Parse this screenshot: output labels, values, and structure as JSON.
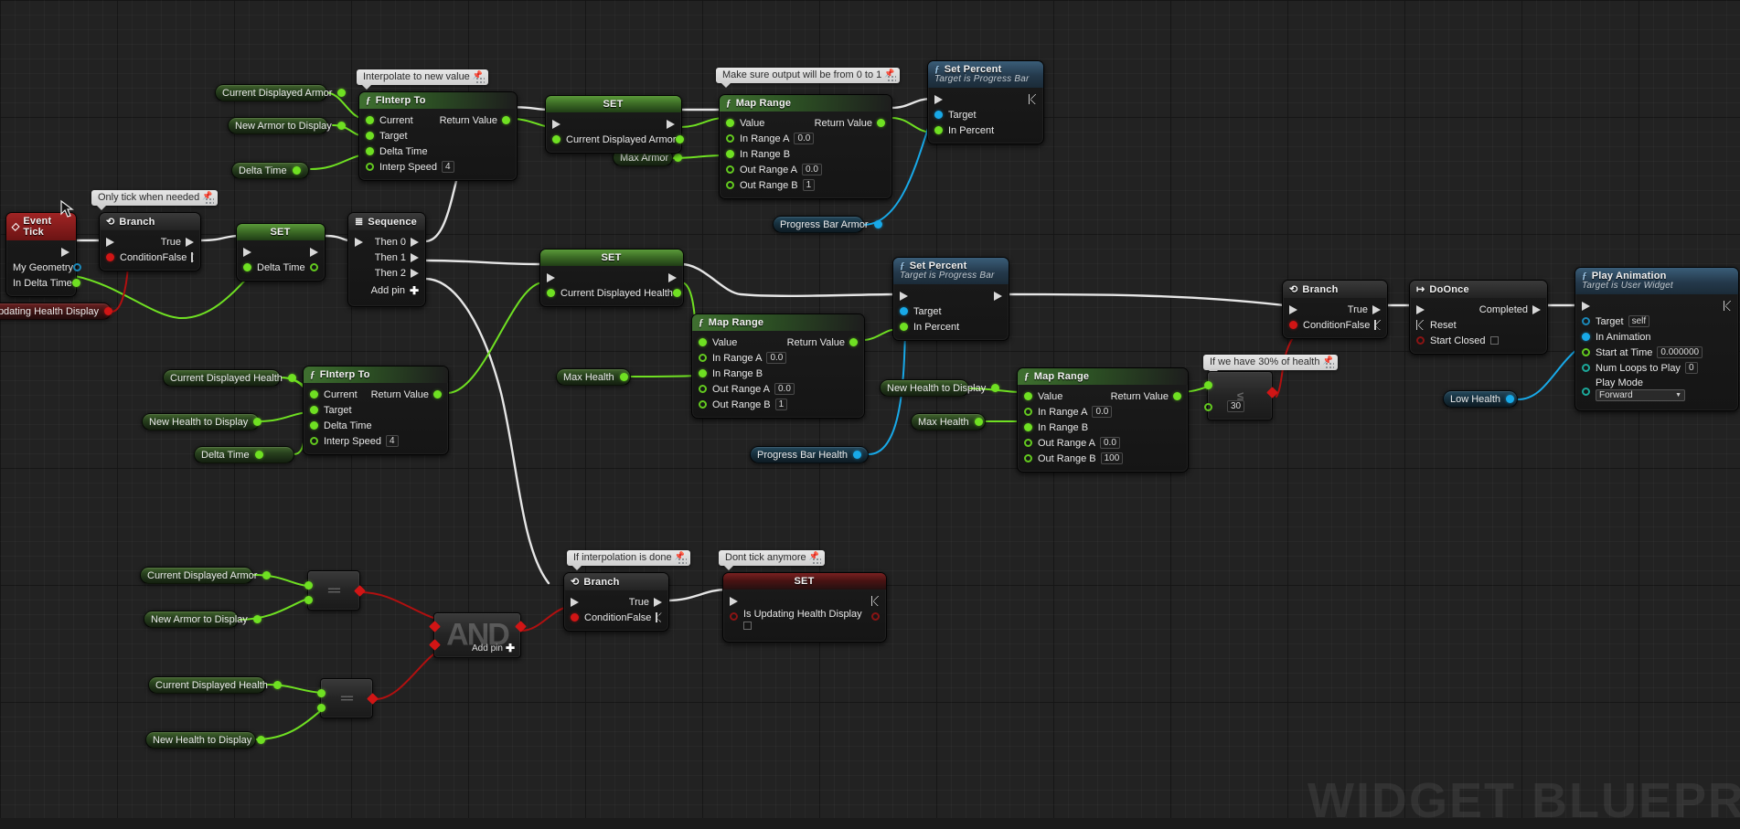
{
  "app": {
    "watermark": "WIDGET BLUEPRINT"
  },
  "comments": [
    {
      "id": "c-only-tick",
      "text": "Only tick when needed"
    },
    {
      "id": "c-interp",
      "text": "Interpolate to new value"
    },
    {
      "id": "c-clamp",
      "text": "Make sure output will be from 0 to 1"
    },
    {
      "id": "c-30pct",
      "text": "If we have 30% of health"
    },
    {
      "id": "c-interp-done",
      "text": "If interpolation is done"
    },
    {
      "id": "c-dont-tick",
      "text": "Dont tick anymore"
    }
  ],
  "nodes": {
    "event_tick": {
      "title": "Event Tick",
      "pins": [
        {
          "label": "My Geometry"
        },
        {
          "label": "In Delta Time"
        }
      ]
    },
    "branch_tick": {
      "title": "Branch",
      "in_label": "Condition",
      "true_label": "True",
      "false_label": "False"
    },
    "set_delta_time": {
      "title": "SET",
      "var_label": "Delta Time"
    },
    "sequence": {
      "title": "Sequence",
      "then0": "Then 0",
      "then1": "Then 1",
      "then2": "Then 2",
      "add_pin": "Add pin"
    },
    "finterp_armor": {
      "title": "FInterp To",
      "pins": [
        "Current",
        "Target",
        "Delta Time"
      ],
      "interp_speed_label": "Interp Speed",
      "interp_speed_value": "4",
      "return_label": "Return Value"
    },
    "finterp_health": {
      "title": "FInterp To",
      "pins": [
        "Current",
        "Target",
        "Delta Time"
      ],
      "interp_speed_label": "Interp Speed",
      "interp_speed_value": "4",
      "return_label": "Return Value"
    },
    "set_armor": {
      "title": "SET",
      "var_label": "Current Displayed Armor"
    },
    "set_health": {
      "title": "SET",
      "var_label": "Current Displayed Health"
    },
    "map_range_armor": {
      "title": "Map Range",
      "value_label": "Value",
      "return_label": "Return Value",
      "in_a_label": "In Range A",
      "in_a_value": "0.0",
      "in_b_label": "In Range B",
      "out_a_label": "Out Range A",
      "out_a_value": "0.0",
      "out_b_label": "Out Range B",
      "out_b_value": "1"
    },
    "map_range_health": {
      "title": "Map Range",
      "value_label": "Value",
      "return_label": "Return Value",
      "in_a_label": "In Range A",
      "in_a_value": "0.0",
      "in_b_label": "In Range B",
      "out_a_label": "Out Range A",
      "out_a_value": "0.0",
      "out_b_label": "Out Range B",
      "out_b_value": "1"
    },
    "map_range_pct": {
      "title": "Map Range",
      "value_label": "Value",
      "return_label": "Return Value",
      "in_a_label": "In Range A",
      "in_a_value": "0.0",
      "in_b_label": "In Range B",
      "out_a_label": "Out Range A",
      "out_a_value": "0.0",
      "out_b_label": "Out Range B",
      "out_b_value": "100"
    },
    "set_percent_armor": {
      "title": "Set Percent",
      "subtitle": "Target is Progress Bar",
      "target_label": "Target",
      "percent_label": "In Percent"
    },
    "set_percent_health": {
      "title": "Set Percent",
      "subtitle": "Target is Progress Bar",
      "target_label": "Target",
      "percent_label": "In Percent"
    },
    "branch_lowhealth": {
      "title": "Branch",
      "in_label": "Condition",
      "true_label": "True",
      "false_label": "False"
    },
    "doonce": {
      "title": "DoOnce",
      "completed_label": "Completed",
      "reset_label": "Reset",
      "start_closed_label": "Start Closed"
    },
    "play_animation": {
      "title": "Play Animation",
      "subtitle": "Target is User Widget",
      "target_label": "Target",
      "target_value": "self",
      "in_animation_label": "In Animation",
      "start_at_time_label": "Start at Time",
      "start_at_time_value": "0.000000",
      "num_loops_label": "Num Loops to Play",
      "num_loops_value": "0",
      "play_mode_label": "Play Mode",
      "play_mode_value": "Forward"
    },
    "branch_done": {
      "title": "Branch",
      "in_label": "Condition",
      "true_label": "True",
      "false_label": "False"
    },
    "set_is_updating": {
      "title": "SET",
      "var_label": "Is Updating Health Display"
    },
    "cmp_lte_30": {
      "glyph": "≤",
      "value": "30"
    },
    "cmp_eq_armor": {
      "glyph": "=="
    },
    "cmp_eq_health": {
      "glyph": "=="
    },
    "and_node": {
      "glyph": "AND",
      "add_pin": "Add pin"
    }
  },
  "variables": [
    {
      "id": "v-cda-top",
      "label": "Current Displayed Armor",
      "kind": "green"
    },
    {
      "id": "v-nad-top",
      "label": "New Armor to Display",
      "kind": "green"
    },
    {
      "id": "v-dt-top",
      "label": "Delta Time",
      "kind": "green"
    },
    {
      "id": "v-maxarmor",
      "label": "Max Armor",
      "kind": "green"
    },
    {
      "id": "v-pbarmor",
      "label": "Progress Bar Armor",
      "kind": "blue"
    },
    {
      "id": "v-uhd",
      "label": "Updating Health Display",
      "kind": "red"
    },
    {
      "id": "v-cdh-mid",
      "label": "Current Displayed Health",
      "kind": "green"
    },
    {
      "id": "v-nhd-mid",
      "label": "New Health to Display",
      "kind": "green"
    },
    {
      "id": "v-dt-mid",
      "label": "Delta Time",
      "kind": "green"
    },
    {
      "id": "v-maxhealth1",
      "label": "Max Health",
      "kind": "green"
    },
    {
      "id": "v-pbhealth",
      "label": "Progress Bar Health",
      "kind": "blue"
    },
    {
      "id": "v-nhd-r",
      "label": "New Health to Display",
      "kind": "green"
    },
    {
      "id": "v-maxhealth2",
      "label": "Max Health",
      "kind": "green"
    },
    {
      "id": "v-lowhealth",
      "label": "Low Health",
      "kind": "blue"
    },
    {
      "id": "v-cda-bot",
      "label": "Current Displayed Armor",
      "kind": "green"
    },
    {
      "id": "v-nad-bot",
      "label": "New Armor to Display",
      "kind": "green"
    },
    {
      "id": "v-cdh-bot",
      "label": "Current Displayed Health",
      "kind": "green"
    },
    {
      "id": "v-nhd-bot",
      "label": "New Health to Display",
      "kind": "green"
    }
  ],
  "colors": {
    "exec_wire": "#e6e6e6",
    "float_wire": "#6fe022",
    "bool_wire": "#b11010",
    "object_wire": "#18a9e8",
    "grid": "#222222"
  }
}
